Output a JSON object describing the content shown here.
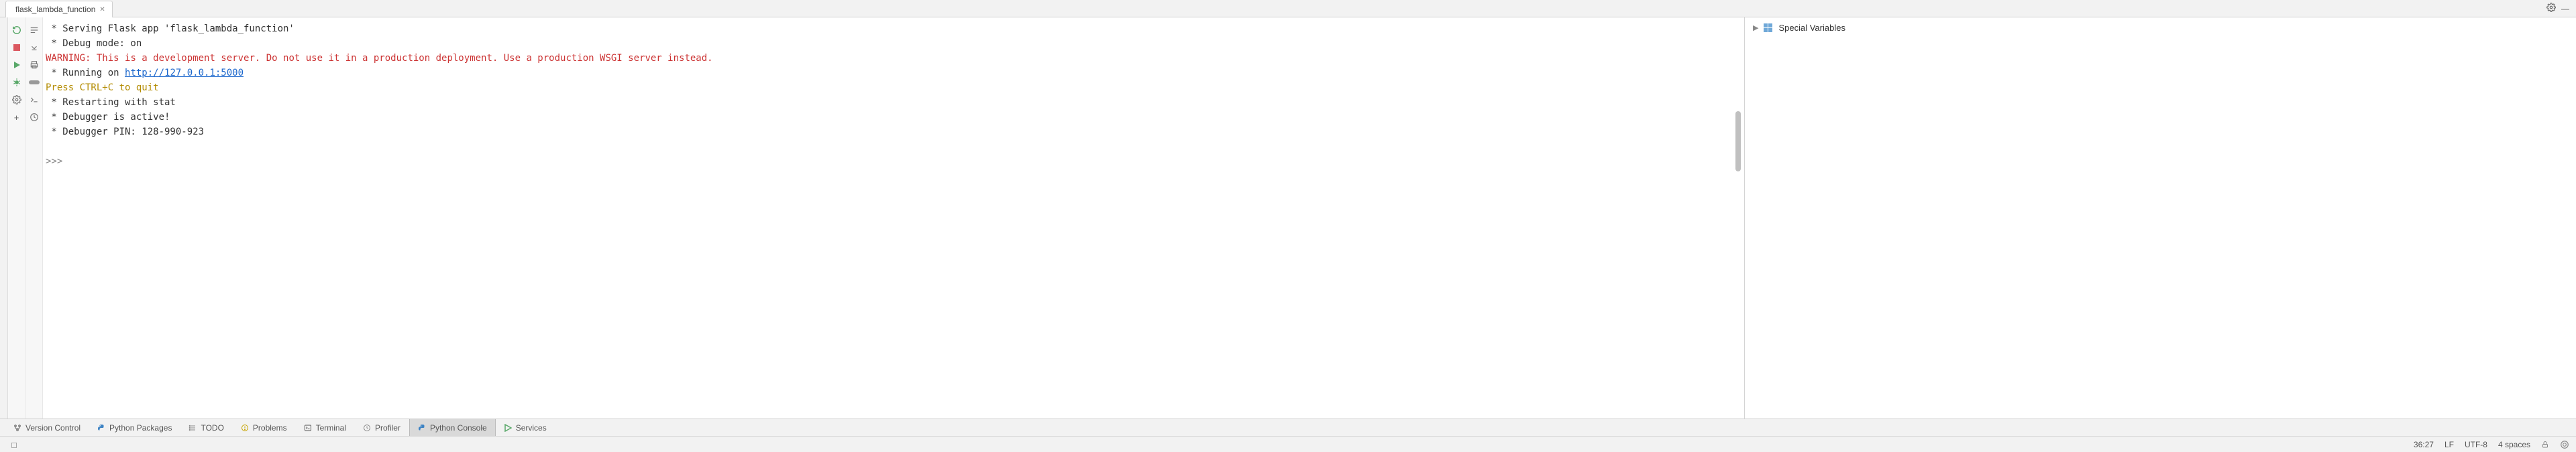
{
  "tab": {
    "label": "flask_lambda_function"
  },
  "console": {
    "line1": " * Serving Flask app 'flask_lambda_function'",
    "line2": " * Debug mode: on",
    "warning_label": "WARNING:",
    "warning_text": " This is a development server. Do not use it in a production deployment. Use a production WSGI server instead.",
    "running_prefix": " * Running on ",
    "running_url": "http://127.0.0.1:5000",
    "ctrlc": "Press CTRL+C to quit",
    "restart": " * Restarting with stat",
    "debugger_active": " * Debugger is active!",
    "debugger_pin": " * Debugger PIN: 128-990-923",
    "prompt": ">>>"
  },
  "variables": {
    "special": "Special Variables"
  },
  "tool_windows": {
    "version_control": "Version Control",
    "python_packages": "Python Packages",
    "todo": "TODO",
    "problems": "Problems",
    "terminal": "Terminal",
    "profiler": "Profiler",
    "python_console": "Python Console",
    "services": "Services"
  },
  "status": {
    "cursor": "36:27",
    "line_sep": "LF",
    "encoding": "UTF-8",
    "indent": "4 spaces"
  }
}
